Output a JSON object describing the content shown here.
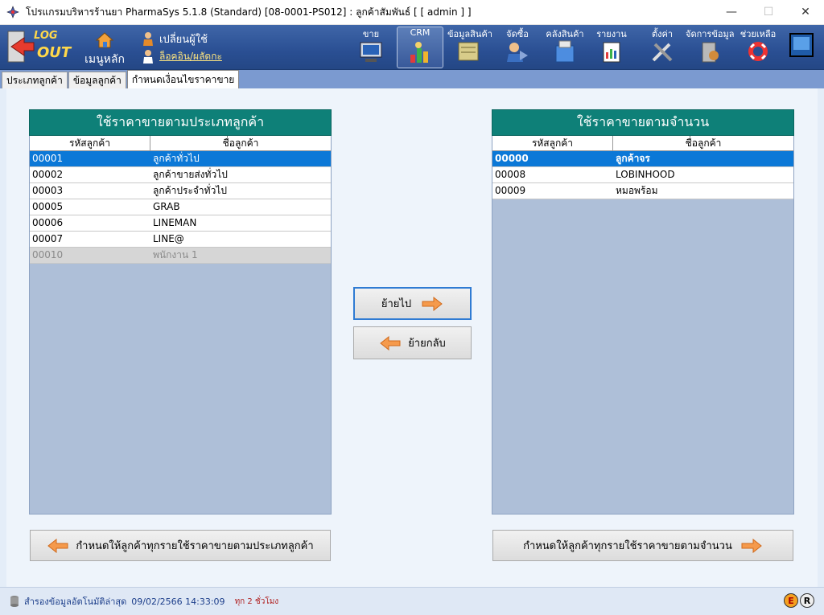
{
  "window": {
    "title": "โปรแกรมบริหารร้านยา PharmaSys 5.1.8 (Standard) [08-0001-PS012] : ลูกค้าสัมพันธ์  [ [ admin ] ]",
    "minimize": "—",
    "maximize": "☐",
    "close": "✕"
  },
  "toolbar": {
    "logout_line1": "LOG",
    "logout_line2": "OUT",
    "home_label": "เมนูหลัก",
    "switch_user_label": "เปลี่ยนผู้ใช้",
    "login_history_label": "ล็อคอิน/ผลัดกะ",
    "items": [
      {
        "label": "ขาย",
        "icon": "pos-icon"
      },
      {
        "label": "CRM",
        "icon": "crm-chart-icon"
      },
      {
        "label": "ข้อมูลสินค้า",
        "icon": "product-icon"
      },
      {
        "label": "จัดซื้อ",
        "icon": "purchase-icon"
      },
      {
        "label": "คลังสินค้า",
        "icon": "warehouse-icon"
      },
      {
        "label": "รายงาน",
        "icon": "report-icon"
      },
      {
        "label": "ตั้งค่า",
        "icon": "settings-icon"
      },
      {
        "label": "จัดการข้อมูล",
        "icon": "data-manage-icon"
      },
      {
        "label": "ช่วยเหลือ",
        "icon": "help-icon"
      }
    ]
  },
  "tabs": [
    {
      "label": "ประเภทลูกค้า",
      "active": false
    },
    {
      "label": "ข้อมูลลูกค้า",
      "active": false
    },
    {
      "label": "กำหนดเงื่อนไขราคาขาย",
      "active": true
    }
  ],
  "left_panel": {
    "title": "ใช้ราคาขายตามประเภทลูกค้า",
    "col_code": "รหัสลูกค้า",
    "col_name": "ชื่อลูกค้า",
    "rows": [
      {
        "code": "00001",
        "name": "ลูกค้าทั่วไป",
        "state": "selected"
      },
      {
        "code": "00002",
        "name": "ลูกค้าขายส่งทั่วไป",
        "state": "normal"
      },
      {
        "code": "00003",
        "name": "ลูกค้าประจำทั่วไป",
        "state": "normal"
      },
      {
        "code": "00005",
        "name": "GRAB",
        "state": "normal"
      },
      {
        "code": "00006",
        "name": "LINEMAN",
        "state": "normal"
      },
      {
        "code": "00007",
        "name": "LINE@",
        "state": "normal"
      },
      {
        "code": "00010",
        "name": "พนักงาน 1",
        "state": "disabled"
      }
    ]
  },
  "right_panel": {
    "title": "ใช้ราคาขายตามจำนวน",
    "col_code": "รหัสลูกค้า",
    "col_name": "ชื่อลูกค้า",
    "rows": [
      {
        "code": "00000",
        "name": "ลูกค้าจร",
        "state": "selected"
      },
      {
        "code": "00008",
        "name": "LOBINHOOD",
        "state": "normal"
      },
      {
        "code": "00009",
        "name": "หมอพร้อม",
        "state": "normal"
      }
    ]
  },
  "buttons": {
    "move_to": "ย้ายไป",
    "move_back": "ย้ายกลับ",
    "set_all_type": "กำหนดให้ลูกค้าทุกรายใช้ราคาขายตามประเภทลูกค้า",
    "set_all_qty": "กำหนดให้ลูกค้าทุกรายใช้ราคาขายตามจำนวน"
  },
  "status": {
    "backup_label": "สำรองข้อมูลอัตโนมัติล่าสุด",
    "timestamp": "09/02/2566 14:33:09",
    "interval": "ทุก 2 ชั่วโมง",
    "badge_e": "E",
    "badge_r": "R"
  },
  "colors": {
    "panel_header": "#0e8078",
    "selected_row": "#0b78d7",
    "toolbar": "#2a4f93"
  }
}
